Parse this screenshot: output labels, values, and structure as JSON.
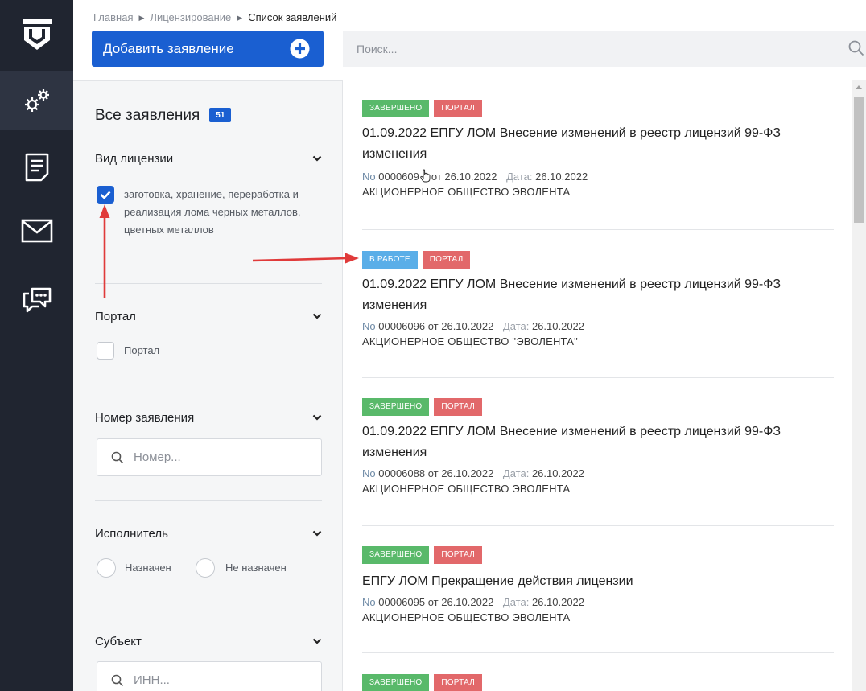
{
  "nav": {
    "items": [
      {
        "name": "settings"
      },
      {
        "name": "applications"
      },
      {
        "name": "mail"
      },
      {
        "name": "chat"
      }
    ]
  },
  "breadcrumb": {
    "items": [
      "Главная",
      "Лицензирование",
      "Список заявлений"
    ]
  },
  "toolbar": {
    "add_label": "Добавить заявление",
    "search_placeholder": "Поиск..."
  },
  "filters": {
    "title": "Все заявления",
    "count": "51",
    "license_type": {
      "title": "Вид лицензии",
      "option_label": "заготовка, хранение, переработка и реализация лома черных металлов, цветных металлов",
      "checked": true
    },
    "portal": {
      "title": "Портал",
      "option_label": "Портал",
      "checked": false
    },
    "number": {
      "title": "Номер заявления",
      "placeholder": "Номер..."
    },
    "executor": {
      "title": "Исполнитель",
      "option_assigned": "Назначен",
      "option_unassigned": "Не назначен"
    },
    "subject": {
      "title": "Субъект",
      "placeholder": "ИНН..."
    }
  },
  "applications": [
    {
      "status": "ЗАВЕРШЕНО",
      "status_color": "#59b96a",
      "source": "ПОРТАЛ",
      "title": "01.09.2022 ЕПГУ ЛОМ Внесение изменений в реестр лицензий 99-ФЗ изменения",
      "no_label": "No",
      "number": "0000609",
      "from": "от 26.10.2022",
      "date_label": "Дата:",
      "date": "26.10.2022",
      "org": "АКЦИОНЕРНОЕ ОБЩЕСТВО ЭВОЛЕНТА"
    },
    {
      "status": "В РАБОТЕ",
      "status_color": "#5aaee8",
      "source": "ПОРТАЛ",
      "title": "01.09.2022 ЕПГУ ЛОМ Внесение изменений в реестр лицензий 99-ФЗ изменения",
      "no_label": "No",
      "number": "00006096",
      "from": "от 26.10.2022",
      "date_label": "Дата:",
      "date": "26.10.2022",
      "org": "АКЦИОНЕРНОЕ ОБЩЕСТВО \"ЭВОЛЕНТА\""
    },
    {
      "status": "ЗАВЕРШЕНО",
      "status_color": "#59b96a",
      "source": "ПОРТАЛ",
      "title": "01.09.2022 ЕПГУ ЛОМ Внесение изменений в реестр лицензий 99-ФЗ изменения",
      "no_label": "No",
      "number": "00006088",
      "from": "от 26.10.2022",
      "date_label": "Дата:",
      "date": "26.10.2022",
      "org": "АКЦИОНЕРНОЕ ОБЩЕСТВО ЭВОЛЕНТА"
    },
    {
      "status": "ЗАВЕРШЕНО",
      "status_color": "#59b96a",
      "source": "ПОРТАЛ",
      "title": "ЕПГУ ЛОМ Прекращение действия лицензии",
      "no_label": "No",
      "number": "00006095",
      "from": "от 26.10.2022",
      "date_label": "Дата:",
      "date": "26.10.2022",
      "org": "АКЦИОНЕРНОЕ ОБЩЕСТВО ЭВОЛЕНТА"
    },
    {
      "status": "ЗАВЕРШЕНО",
      "status_color": "#59b96a",
      "source": "ПОРТАЛ"
    }
  ]
}
